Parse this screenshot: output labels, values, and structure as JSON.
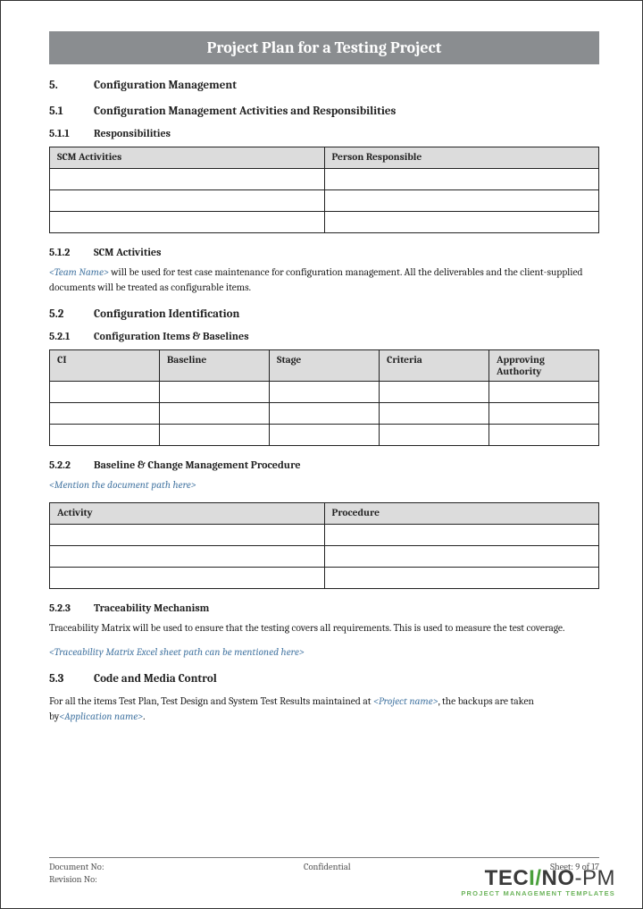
{
  "title": "Project Plan for a Testing Project",
  "sections": {
    "s5": {
      "num": "5.",
      "title": "Configuration Management"
    },
    "s51": {
      "num": "5.1",
      "title": "Configuration Management Activities and Responsibilities"
    },
    "s511": {
      "num": "5.1.1",
      "title": "Responsibilities"
    },
    "s512": {
      "num": "5.1.2",
      "title": "SCM Activities"
    },
    "s52": {
      "num": "5.2",
      "title": "Configuration Identification"
    },
    "s521": {
      "num": "5.2.1",
      "title": "Configuration Items & Baselines"
    },
    "s522": {
      "num": "5.2.2",
      "title": "Baseline & Change Management Procedure"
    },
    "s523": {
      "num": "5.2.3",
      "title": "Traceability Mechanism"
    },
    "s53": {
      "num": "5.3",
      "title": "Code and Media Control"
    }
  },
  "table511": {
    "headers": [
      "SCM Activities",
      "Person Responsible"
    ]
  },
  "body512": {
    "placeholder": "<Team Name>",
    "text": " will be used for test case maintenance for configuration management. All the deliverables and the client-supplied documents will be treated as configurable items."
  },
  "table521": {
    "headers": [
      "CI",
      "Baseline",
      "Stage",
      "Criteria",
      "Approving Authority"
    ]
  },
  "body522": {
    "placeholder": "<Mention the document path here>"
  },
  "table522": {
    "headers": [
      "Activity",
      "Procedure"
    ]
  },
  "body523": {
    "text": "Traceability Matrix will be used to ensure that the testing covers all requirements. This is used to measure the test coverage.",
    "placeholder": "<Traceability Matrix Excel sheet path can be mentioned here>"
  },
  "body53": {
    "pre": "For all the items Test Plan, Test Design and System Test Results maintained at ",
    "ph1": "<Project name>",
    "mid": ", the backups are taken by",
    "ph2": "<Application name>",
    "post": "."
  },
  "footer": {
    "docno": "Document No:",
    "conf": "Confidential",
    "sheet": "Sheet: 9 of 17",
    "rev": "Revision No:"
  },
  "logo": {
    "t1": "TEC",
    "t2": "I/",
    "t3": "NO",
    "t4": "-PM",
    "sub": "PROJECT MANAGEMENT TEMPLATES"
  }
}
